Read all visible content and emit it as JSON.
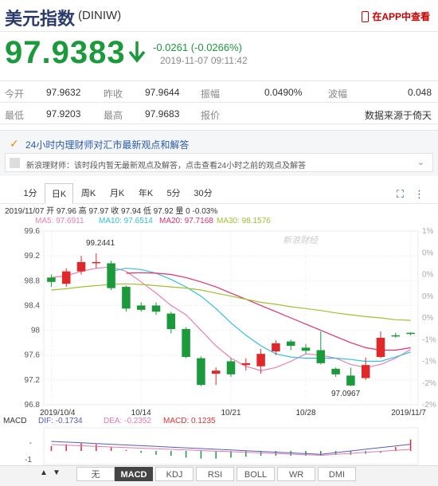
{
  "header": {
    "title": "美元指数",
    "code": "(DINIW)",
    "app_label": "在APP中查看"
  },
  "quote": {
    "price": "97.9383",
    "change": "-0.0261 (-0.0266%)",
    "time": "2019-11-07 09:11:42"
  },
  "stats": [
    [
      {
        "l": "今开",
        "v": "97.9632"
      },
      {
        "l": "昨收",
        "v": "97.9644"
      },
      {
        "l": "振幅",
        "v": "0.0490%"
      },
      {
        "l": "波幅",
        "v": "0.048"
      }
    ],
    [
      {
        "l": "最低",
        "v": "97.9203"
      },
      {
        "l": "最高",
        "v": "97.9683"
      },
      {
        "l": "报价",
        "v": ""
      },
      {
        "l": "",
        "v": "数据来源于倚天"
      }
    ]
  ],
  "news": {
    "headline": "24小时内理财师对汇市最新观点和解答",
    "message": "新浪理财师：该时段内暂无最新观点及解答，点击查看24小时之前的观点及解答"
  },
  "tabs": [
    "1分",
    "日K",
    "周K",
    "月K",
    "年K",
    "5分",
    "30分"
  ],
  "chart": {
    "info": "2019/11/07  开 97.96  高 97.97  收 97.94  低 97.92  量 0  -0.03%",
    "ma5": "MA5: 97.6911",
    "ma10": "MA10: 97.6514",
    "ma20": "MA20: 97.7168",
    "ma30": "MA30: 98.1576",
    "watermark": "新浪财经",
    "high_label": "99.2441",
    "low_label": "97.0967",
    "yticks": [
      "99.6",
      "99.2",
      "98.8",
      "98.4",
      "98",
      "97.6",
      "97.2",
      "96.8"
    ],
    "pticks": [
      "1%",
      "0%",
      "0%",
      "0%",
      "0%",
      "-1%",
      "-1%",
      "-2%",
      "-2%"
    ],
    "xticks": [
      "2019/10/4",
      "10/14",
      "10/21",
      "10/28",
      "2019/11/7"
    ],
    "macd_label": "MACD",
    "dif": "DIF: -0.1734",
    "dea": "DEA: -0.2352",
    "macd": "MACD: 0.1235",
    "macd_yticks": [
      "-",
      "-1"
    ]
  },
  "chart_data": {
    "type": "candlestick",
    "ylim": [
      96.8,
      99.6
    ],
    "candles": [
      {
        "o": 98.85,
        "c": 98.78,
        "h": 98.9,
        "l": 98.7
      },
      {
        "o": 98.75,
        "c": 98.95,
        "h": 99.0,
        "l": 98.7
      },
      {
        "o": 98.95,
        "c": 99.1,
        "h": 99.2,
        "l": 98.9
      },
      {
        "o": 99.1,
        "c": 99.1,
        "h": 99.24,
        "l": 99.0
      },
      {
        "o": 99.08,
        "c": 98.68,
        "h": 99.12,
        "l": 98.65
      },
      {
        "o": 98.7,
        "c": 98.35,
        "h": 98.72,
        "l": 98.3
      },
      {
        "o": 98.4,
        "c": 98.33,
        "h": 98.45,
        "l": 98.3
      },
      {
        "o": 98.4,
        "c": 98.3,
        "h": 98.45,
        "l": 98.25
      },
      {
        "o": 98.27,
        "c": 98.02,
        "h": 98.3,
        "l": 97.95
      },
      {
        "o": 98.02,
        "c": 97.57,
        "h": 98.05,
        "l": 97.55
      },
      {
        "o": 97.55,
        "c": 97.12,
        "h": 97.58,
        "l": 97.1
      },
      {
        "o": 97.3,
        "c": 97.35,
        "h": 97.4,
        "l": 97.12
      },
      {
        "o": 97.5,
        "c": 97.29,
        "h": 97.55,
        "l": 97.25
      },
      {
        "o": 97.44,
        "c": 97.47,
        "h": 97.55,
        "l": 97.35
      },
      {
        "o": 97.42,
        "c": 97.62,
        "h": 97.7,
        "l": 97.3
      },
      {
        "o": 97.66,
        "c": 97.79,
        "h": 97.84,
        "l": 97.6
      },
      {
        "o": 97.82,
        "c": 97.75,
        "h": 97.85,
        "l": 97.68
      },
      {
        "o": 97.72,
        "c": 97.67,
        "h": 97.78,
        "l": 97.62
      },
      {
        "o": 97.68,
        "c": 97.47,
        "h": 97.98,
        "l": 97.45
      },
      {
        "o": 97.38,
        "c": 97.29,
        "h": 97.4,
        "l": 97.25
      },
      {
        "o": 97.27,
        "c": 97.11,
        "h": 97.4,
        "l": 97.1
      },
      {
        "o": 97.23,
        "c": 97.44,
        "h": 97.56,
        "l": 97.2
      },
      {
        "o": 97.57,
        "c": 97.88,
        "h": 97.98,
        "l": 97.55
      },
      {
        "o": 97.92,
        "c": 97.9,
        "h": 97.96,
        "l": 97.88
      },
      {
        "o": 97.96,
        "c": 97.94,
        "h": 97.97,
        "l": 97.92
      }
    ],
    "ma_lines": [
      {
        "name": "MA5",
        "color": "#e880b0",
        "values": [
          98.85,
          98.88,
          98.95,
          99.0,
          99.02,
          98.95,
          98.78,
          98.6,
          98.4,
          98.25,
          98.0,
          97.75,
          97.55,
          97.42,
          97.35,
          97.4,
          97.5,
          97.62,
          97.6,
          97.55,
          97.45,
          97.4,
          97.45,
          97.55,
          97.69
        ]
      },
      {
        "name": "MA10",
        "color": "#31c0e0",
        "values": [
          null,
          null,
          null,
          null,
          98.95,
          99.0,
          98.98,
          98.92,
          98.82,
          98.7,
          98.55,
          98.35,
          98.12,
          97.92,
          97.75,
          97.62,
          97.57,
          97.55,
          97.55,
          97.55,
          97.53,
          97.5,
          97.5,
          97.57,
          97.65
        ]
      },
      {
        "name": "MA20",
        "color": "#e0306a",
        "values": [
          null,
          null,
          null,
          null,
          null,
          98.92,
          98.93,
          98.92,
          98.9,
          98.85,
          98.78,
          98.7,
          98.6,
          98.5,
          98.4,
          98.3,
          98.2,
          98.1,
          98.0,
          97.9,
          97.8,
          97.72,
          97.68,
          97.68,
          97.72
        ]
      },
      {
        "name": "MA30",
        "color": "#a0c030",
        "values": [
          98.65,
          98.67,
          98.7,
          98.72,
          98.74,
          98.75,
          98.74,
          98.72,
          98.7,
          98.68,
          98.65,
          98.6,
          98.55,
          98.5,
          98.45,
          98.42,
          98.38,
          98.35,
          98.32,
          98.28,
          98.25,
          98.22,
          98.2,
          98.17,
          98.16
        ]
      }
    ],
    "macd_hist": [
      0.05,
      0.07,
      0.08,
      0.07,
      0.04,
      0.01,
      -0.02,
      -0.04,
      -0.05,
      -0.07,
      -0.08,
      -0.08,
      -0.07,
      -0.06,
      -0.05,
      -0.05,
      -0.05,
      -0.05,
      -0.05,
      -0.04,
      -0.04,
      -0.03,
      -0.02,
      0.04,
      0.12
    ]
  },
  "bottom_tabs": [
    "无",
    "MACD",
    "KDJ",
    "RSI",
    "BOLL",
    "WR",
    "DMI"
  ]
}
